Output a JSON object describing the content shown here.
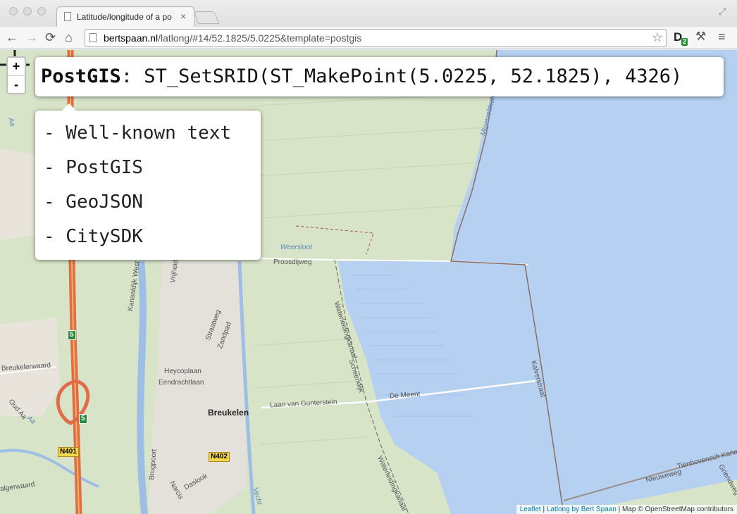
{
  "browser": {
    "tab_title": "Latitude/longitude of a po",
    "tab_close": "×",
    "url_host": "bertspaan.nl",
    "url_path": "/latlong/#14/52.1825/5.0225&template=postgis",
    "back": "←",
    "forward": "→",
    "reload": "⟳",
    "home": "⌂",
    "star": "☆",
    "ext_letter": "D",
    "ext_badge": "2",
    "wrench": "⚒",
    "menu": "≡",
    "fullscreen": "⤢"
  },
  "map": {
    "zoom_in": "+",
    "zoom_out": "-",
    "coord_format": "PostGIS",
    "coord_value": ": ST_SetSRID(ST_MakePoint(5.0225, 52.1825), 4326)",
    "menu_items": [
      "- Well-known text",
      "- PostGIS",
      "- GeoJSON",
      "- CitySDK"
    ],
    "labels": {
      "weersloot": "Weersloot",
      "proosdijweg": "Proosdijweg",
      "muyeveldsche": "Muyeveldsche Wetering",
      "waterleiding1": "Waterleidingkanaal",
      "waterleiding2": "Waterleidingkanaal",
      "schepdijk": "Scheendijk",
      "kalverstraat": "Kalverstraat",
      "breukelen": "Breukelen",
      "de_meent": "De Meent",
      "laan": "Laan van Gunterstein",
      "straatweg": "Straatweg",
      "zandpad": "Zandpad",
      "heycoplaan": "Heycoplaan",
      "eendracht": "Eendrachtlaan",
      "brugpoort": "Brugpoort",
      "daslook": "Daslook",
      "nieuweweg": "Nieuweweg",
      "tienhovensch": "Tienhovensch Kanaal",
      "breukelerwaard": "Breukelerwaard",
      "kanaaldijk": "Kanaaldijk West",
      "vrijheidslaan": "Vrijheidslaan",
      "vecht": "Vecht",
      "aa1": "Aa",
      "aa2": "Aa",
      "oud_aa": "Oud Aa",
      "naruto": "Narcis",
      "griendweg": "Griendweg",
      "elgerwaard": "algerwaard"
    },
    "shields": {
      "n401": "N401",
      "n402": "N402",
      "a2_top": "5",
      "a2_bottom": "5"
    },
    "attribution": {
      "leaflet": "Leaflet",
      "sep1": " | ",
      "latlong": "Latlong by Bert Spaan",
      "rest": " | Map © OpenStreetMap contributors"
    },
    "colors": {
      "water": "#b5d0f0",
      "land": "#d8e4c8",
      "urban": "#e4e0da",
      "motorway": "#e06c4a"
    }
  }
}
